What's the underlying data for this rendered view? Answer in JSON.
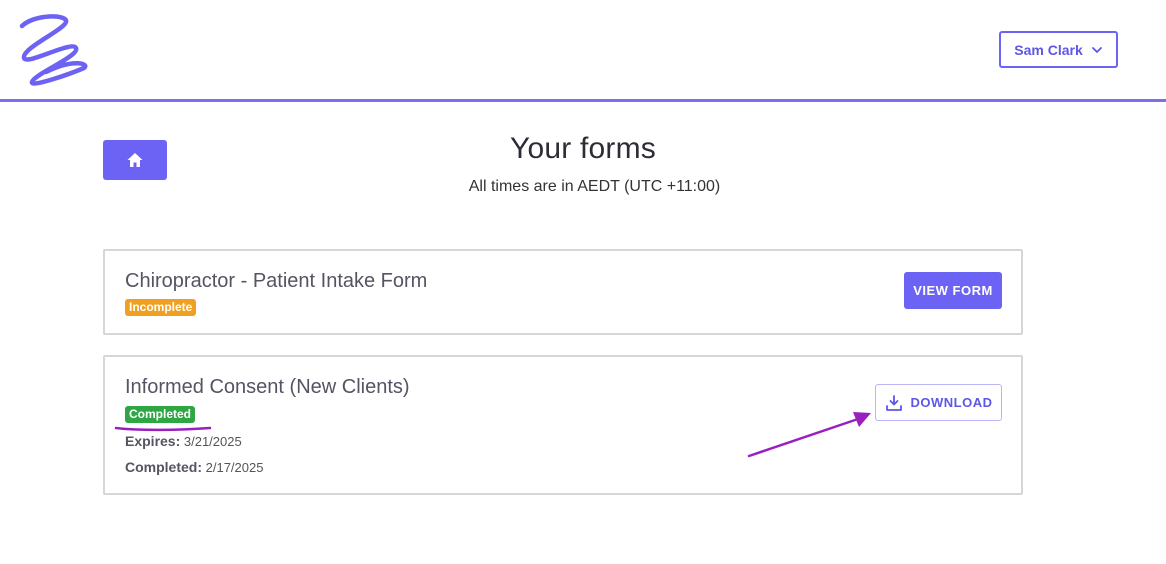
{
  "header": {
    "user_name": "Sam Clark",
    "accent_color": "#6c63f4"
  },
  "page": {
    "title": "Your forms",
    "timezone_note": "All times are in AEDT (UTC +11:00)"
  },
  "forms": [
    {
      "title": "Chiropractor - Patient Intake Form",
      "status": "Incomplete",
      "status_color": "#f0a020",
      "action_label": "VIEW FORM"
    },
    {
      "title": "Informed Consent (New Clients)",
      "status": "Completed",
      "status_color": "#2fa644",
      "expires_label": "Expires:",
      "expires_value": "3/21/2025",
      "completed_label": "Completed:",
      "completed_value": "2/17/2025",
      "action_label": "DOWNLOAD"
    }
  ],
  "annotation_color": "#9a1fbf"
}
